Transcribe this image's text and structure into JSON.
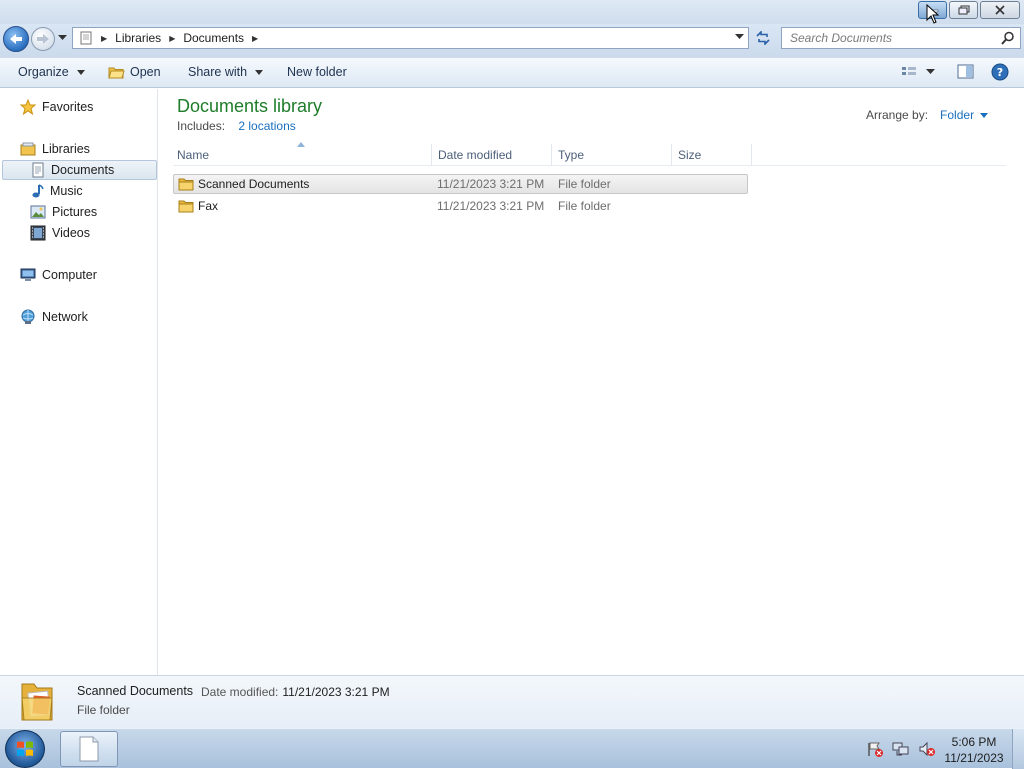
{
  "window": {
    "minimize_icon": "minimize-icon",
    "maximize_icon": "restore-icon",
    "close_icon": "close-icon"
  },
  "address_bar": {
    "breadcrumbs": [
      "Libraries",
      "Documents"
    ],
    "search_placeholder": "Search Documents"
  },
  "toolbar": {
    "organize": "Organize",
    "open": "Open",
    "share_with": "Share with",
    "new_folder": "New folder"
  },
  "nav_pane": {
    "favorites": "Favorites",
    "libraries": "Libraries",
    "library_items": [
      "Documents",
      "Music",
      "Pictures",
      "Videos"
    ],
    "computer": "Computer",
    "network": "Network",
    "selected": "Documents"
  },
  "content": {
    "title": "Documents library",
    "includes_label": "Includes:",
    "includes_link": "2 locations",
    "arrange_label": "Arrange by:",
    "arrange_value": "Folder",
    "columns": [
      "Name",
      "Date modified",
      "Type",
      "Size"
    ],
    "rows": [
      {
        "name": "Scanned Documents",
        "date": "11/21/2023 3:21 PM",
        "type": "File folder",
        "size": "",
        "selected": true
      },
      {
        "name": "Fax",
        "date": "11/21/2023 3:21 PM",
        "type": "File folder",
        "size": "",
        "selected": false
      }
    ]
  },
  "details": {
    "name": "Scanned Documents",
    "date_label": "Date modified:",
    "date_value": "11/21/2023 3:21 PM",
    "type": "File folder"
  },
  "taskbar": {
    "time": "5:06 PM",
    "date": "11/21/2023"
  },
  "colors": {
    "title_green": "#1e7d2a",
    "link_blue": "#1a6fbf",
    "accent_blue": "#2a6fc0"
  }
}
